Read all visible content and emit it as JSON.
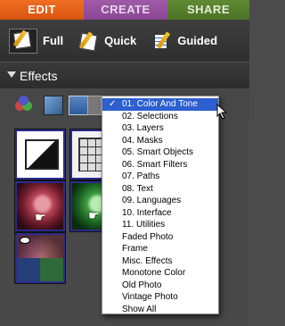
{
  "tabs": [
    {
      "label": "EDIT"
    },
    {
      "label": "CREATE"
    },
    {
      "label": "SHARE"
    }
  ],
  "modes": [
    {
      "label": "Full",
      "icon": "full-edit-icon"
    },
    {
      "label": "Quick",
      "icon": "quick-edit-icon"
    },
    {
      "label": "Guided",
      "icon": "guided-edit-icon"
    }
  ],
  "effects": {
    "title": "Effects"
  },
  "menu": {
    "selected_index": 0,
    "items": [
      "01. Color And Tone",
      "02. Selections",
      "03. Layers",
      "04. Masks",
      "05. Smart Objects",
      "06. Smart Filters",
      "07. Paths",
      "08. Text",
      "09. Languages",
      "10. Interface",
      "11. Utilities",
      "Faded Photo",
      "Frame",
      "Misc. Effects",
      "Monotone Color",
      "Old Photo",
      "Vintage Photo",
      "Show All"
    ]
  },
  "colors": {
    "edit_tab": "#e8641a",
    "create_tab": "#954f9e",
    "share_tab": "#557f2d",
    "selection": "#2d5fcf"
  }
}
